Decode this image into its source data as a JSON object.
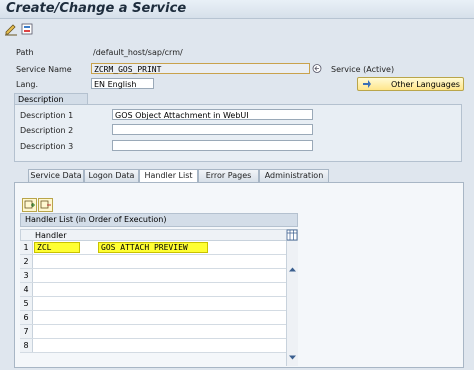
{
  "window": {
    "title": "Create/Change a Service"
  },
  "form": {
    "path_label": "Path",
    "path_value": "/default_host/sap/crm/",
    "service_name_label": "Service Name",
    "service_name_value": "ZCRM_GOS_PRINT",
    "service_status": "Service (Active)",
    "lang_label": "Lang.",
    "lang_value": "EN English",
    "other_languages_label": "Other Languages"
  },
  "description": {
    "header": "Description",
    "rows": [
      {
        "label": "Description 1",
        "value": "GOS Object Attachment in WebUI"
      },
      {
        "label": "Description 2",
        "value": ""
      },
      {
        "label": "Description 3",
        "value": ""
      }
    ]
  },
  "tabs": [
    "Service Data",
    "Logon Data",
    "Handler List",
    "Error Pages",
    "Administration"
  ],
  "active_tab": "Handler List",
  "handler_list": {
    "title": "Handler List (in Order of Execution)",
    "column_header": "Handler",
    "rows": [
      {
        "num": "1",
        "part1": "ZCL",
        "part2": "GOS ATTACH PREVIEW"
      },
      {
        "num": "2"
      },
      {
        "num": "3"
      },
      {
        "num": "4"
      },
      {
        "num": "5"
      },
      {
        "num": "6"
      },
      {
        "num": "7"
      },
      {
        "num": "8"
      }
    ]
  }
}
